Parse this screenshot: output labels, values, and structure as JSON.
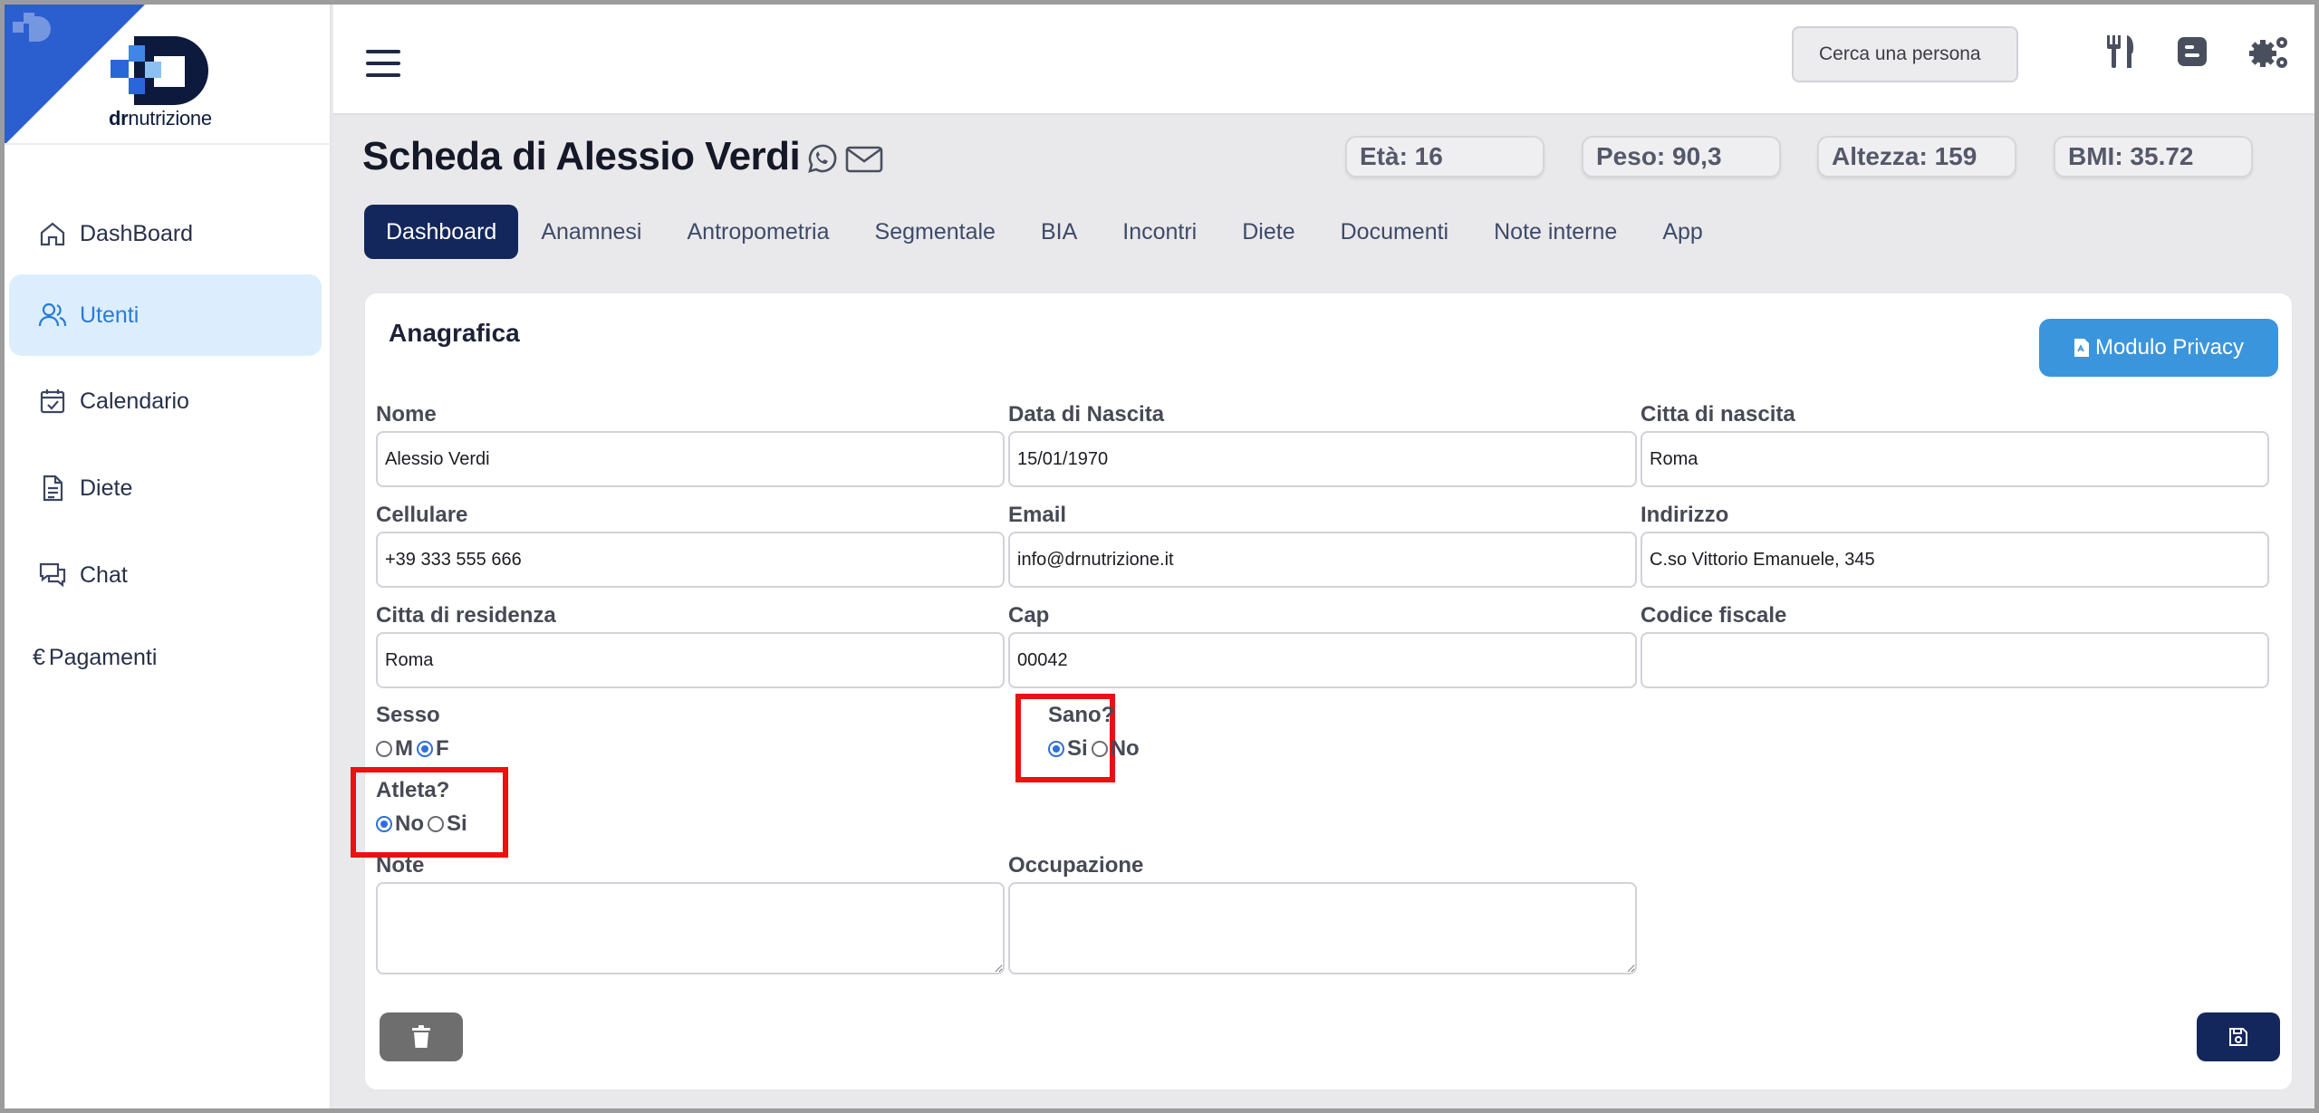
{
  "brand": {
    "name_bold": "dr",
    "name_rest": "nutrizione"
  },
  "sidebar": {
    "items": [
      {
        "label": "DashBoard",
        "icon": "home-icon"
      },
      {
        "label": "Utenti",
        "icon": "users-icon",
        "active": true
      },
      {
        "label": "Calendario",
        "icon": "calendar-icon"
      },
      {
        "label": "Diete",
        "icon": "document-icon"
      },
      {
        "label": "Chat",
        "icon": "chat-icon"
      },
      {
        "label": "Pagamenti",
        "prefix": "€"
      }
    ]
  },
  "topbar": {
    "search_placeholder": "Cerca una persona",
    "icons": [
      "fork-knife-icon",
      "blogger-icon",
      "cogs-icon"
    ]
  },
  "header": {
    "title": "Scheda di Alessio Verdi",
    "stats": [
      "Età: 16",
      "Peso: 90,3",
      "Altezza: 159",
      "BMI: 35.72"
    ]
  },
  "tabs": [
    "Dashboard",
    "Anamnesi",
    "Antropometria",
    "Segmentale",
    "BIA",
    "Incontri",
    "Diete",
    "Documenti",
    "Note interne",
    "App"
  ],
  "active_tab": "Dashboard",
  "card": {
    "title": "Anagrafica",
    "privacy_button": "Modulo Privacy",
    "fields": {
      "nome": {
        "label": "Nome",
        "value": "Alessio Verdi"
      },
      "data_nascita": {
        "label": "Data di Nascita",
        "value": "15/01/1970"
      },
      "citta_nascita": {
        "label": "Citta di nascita",
        "value": "Roma"
      },
      "cellulare": {
        "label": "Cellulare",
        "value": "+39 333 555 666"
      },
      "email": {
        "label": "Email",
        "value": "info@drnutrizione.it"
      },
      "indirizzo": {
        "label": "Indirizzo",
        "value": "C.so Vittorio Emanuele, 345"
      },
      "citta_residenza": {
        "label": "Citta di residenza",
        "value": "Roma"
      },
      "cap": {
        "label": "Cap",
        "value": "00042"
      },
      "codice_fiscale": {
        "label": "Codice fiscale",
        "value": ""
      },
      "note": {
        "label": "Note",
        "value": ""
      },
      "occupazione": {
        "label": "Occupazione",
        "value": ""
      }
    },
    "sesso": {
      "label": "Sesso",
      "options": [
        "M",
        "F"
      ],
      "selected": "F"
    },
    "sano": {
      "label": "Sano?",
      "options": [
        "Si",
        "No"
      ],
      "selected": "Si"
    },
    "atleta": {
      "label": "Atleta?",
      "options": [
        "No",
        "Si"
      ],
      "selected": "No"
    }
  },
  "colors": {
    "accent": "#14275c",
    "primary_button": "#3b95dc",
    "sidebar_active_bg": "#dceefd",
    "sidebar_active_text": "#2a7bd8",
    "highlight": "#ec1010"
  }
}
